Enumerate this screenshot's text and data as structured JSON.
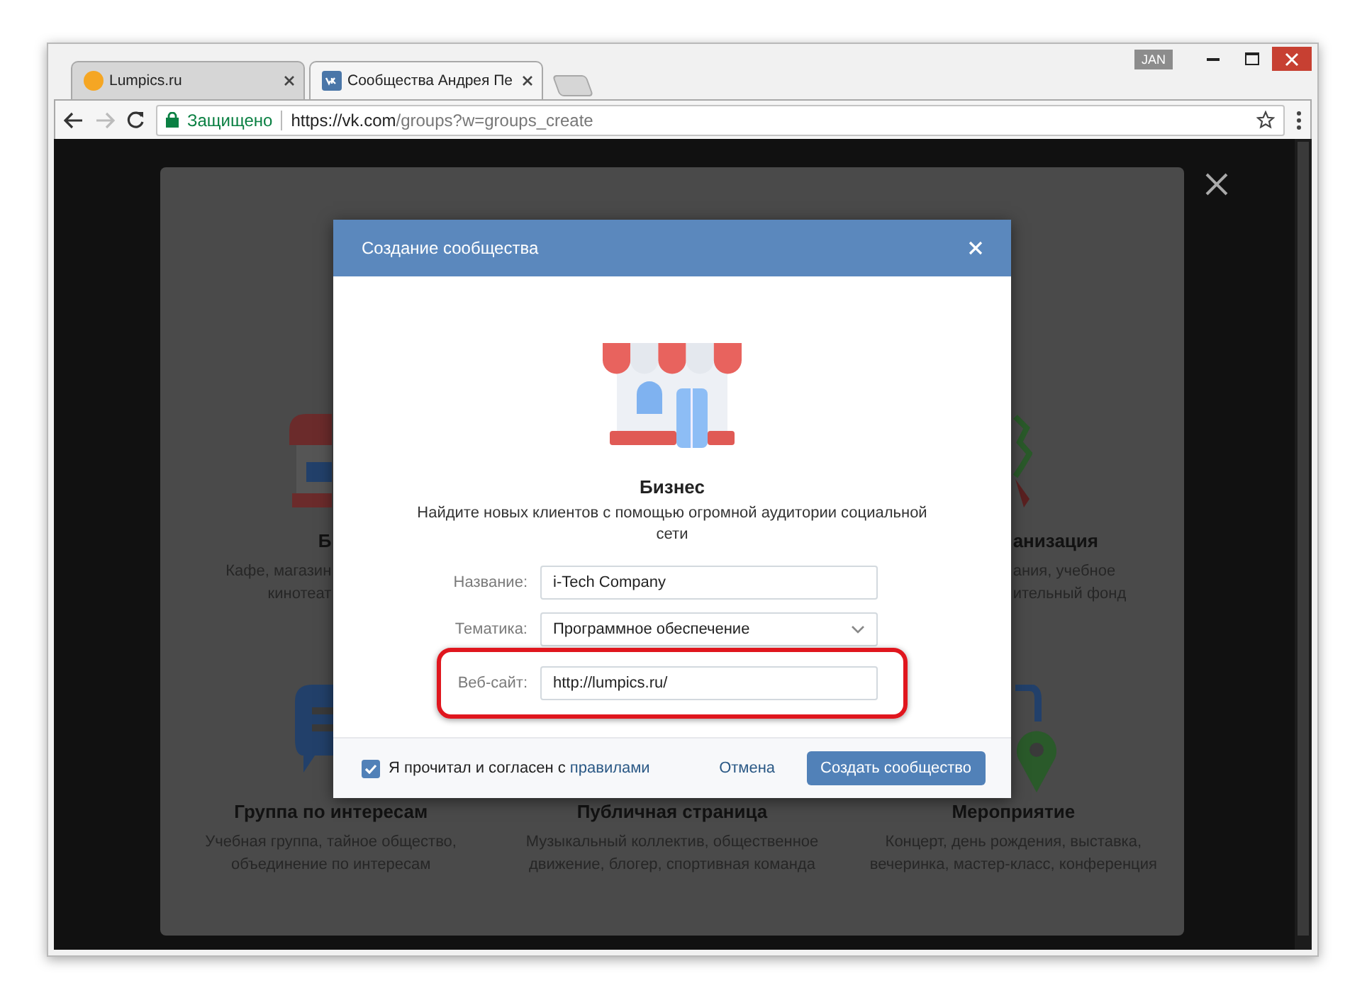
{
  "browser": {
    "tabs": [
      {
        "title": "Lumpics.ru",
        "selected": false
      },
      {
        "title": "Сообщества Андрея Пе",
        "selected": true
      }
    ],
    "profile": "JAN",
    "forward_disabled": true,
    "address": {
      "secure_label": "Защищено",
      "host": "https://vk.com",
      "path": "/groups?w=groups_create"
    }
  },
  "background": {
    "tiles": [
      {
        "kind": "cut-left",
        "title": "Б",
        "description": [
          "Кафе, магазин",
          "кинотеат"
        ]
      },
      {
        "kind": "hidden"
      },
      {
        "kind": "cut-right",
        "title": "анизация",
        "description": [
          "ания, учебное",
          "ительный фонд"
        ]
      },
      {
        "kind": "full",
        "title": "Группа по интересам",
        "description": [
          "Учебная группа, тайное общество,",
          "объединение по интересам"
        ]
      },
      {
        "kind": "full",
        "title": "Публичная страница",
        "description": [
          "Музыкальный коллектив, общественное",
          "движение, блогер, спортивная команда"
        ]
      },
      {
        "kind": "full",
        "title": "Мероприятие",
        "description": [
          "Концерт, день рождения, выставка,",
          "вечеринка, мастер-класс, конференция"
        ]
      }
    ]
  },
  "modal": {
    "title": "Создание сообщества",
    "heading": "Бизнес",
    "description": "Найдите новых клиентов с помощью огромной аудитории социальной сети",
    "fields": [
      {
        "kind": "text",
        "label": "Название:",
        "value": "i-Tech Company",
        "highlighted": false
      },
      {
        "kind": "select",
        "label": "Тематика:",
        "value": "Программное обеспечение",
        "highlighted": false
      },
      {
        "kind": "text",
        "label": "Веб-сайт:",
        "value": "http://lumpics.ru/",
        "highlighted": true
      }
    ],
    "agreement": {
      "checked": true,
      "text": "Я прочитал и согласен с",
      "link": "правилами"
    },
    "cancel": "Отмена",
    "submit": "Создать сообщество"
  }
}
